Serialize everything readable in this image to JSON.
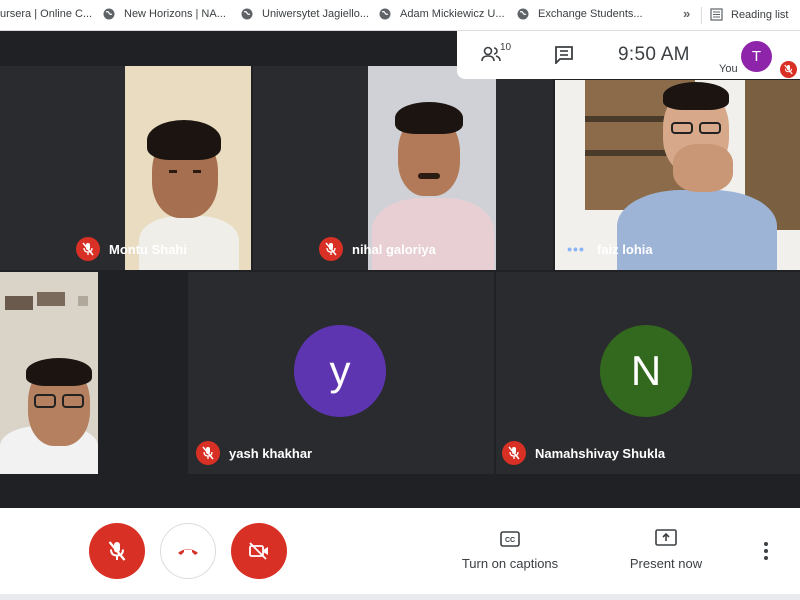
{
  "bookmarks": {
    "items": [
      {
        "label": "ursera | Online C..."
      },
      {
        "label": "New Horizons | NA..."
      },
      {
        "label": "Uniwersytet Jagiello..."
      },
      {
        "label": "Adam Mickiewicz U..."
      },
      {
        "label": "Exchange Students..."
      }
    ],
    "more": "»",
    "reading_list": "Reading list"
  },
  "info": {
    "participants_count": "10",
    "time": "9:50 AM",
    "you_initial": "T",
    "you_label": "You"
  },
  "participants": [
    {
      "name": "Montu Shahi",
      "status": "muted"
    },
    {
      "name": "nihal galoriya",
      "status": "muted"
    },
    {
      "name": "faiz lohia",
      "status": "speaking"
    },
    {
      "name": "yash khakhar",
      "status": "muted",
      "initial": "y",
      "color": "#5e35b1"
    },
    {
      "name": "Namahshivay Shukla",
      "status": "muted",
      "initial": "N",
      "color": "#33691e"
    }
  ],
  "controls": {
    "captions_label": "Turn on captions",
    "present_label": "Present now"
  },
  "colors": {
    "danger": "#d93025",
    "stage": "#202124",
    "you_avatar": "#8e24aa"
  }
}
